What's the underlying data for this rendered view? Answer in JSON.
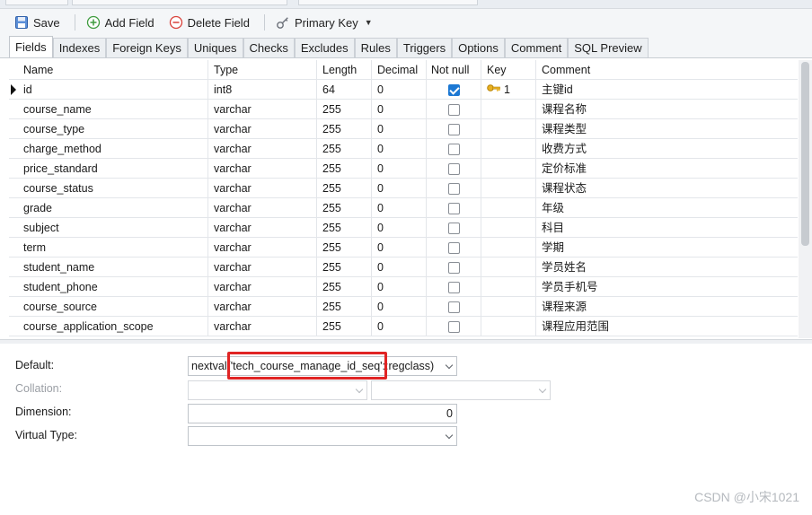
{
  "toolbar": {
    "save": "Save",
    "add_field": "Add Field",
    "delete_field": "Delete Field",
    "primary_key": "Primary Key"
  },
  "tabs": [
    "Fields",
    "Indexes",
    "Foreign Keys",
    "Uniques",
    "Checks",
    "Excludes",
    "Rules",
    "Triggers",
    "Options",
    "Comment",
    "SQL Preview"
  ],
  "active_tab": "Fields",
  "grid": {
    "columns": [
      "Name",
      "Type",
      "Length",
      "Decimal",
      "Not null",
      "Key",
      "Comment"
    ],
    "rows": [
      {
        "name": "id",
        "type": "int8",
        "length": "64",
        "decimal": "0",
        "not_null": true,
        "key": "1",
        "comment": "主键id"
      },
      {
        "name": "course_name",
        "type": "varchar",
        "length": "255",
        "decimal": "0",
        "not_null": false,
        "key": "",
        "comment": "课程名称"
      },
      {
        "name": "course_type",
        "type": "varchar",
        "length": "255",
        "decimal": "0",
        "not_null": false,
        "key": "",
        "comment": "课程类型"
      },
      {
        "name": "charge_method",
        "type": "varchar",
        "length": "255",
        "decimal": "0",
        "not_null": false,
        "key": "",
        "comment": "收费方式"
      },
      {
        "name": "price_standard",
        "type": "varchar",
        "length": "255",
        "decimal": "0",
        "not_null": false,
        "key": "",
        "comment": "定价标准"
      },
      {
        "name": "course_status",
        "type": "varchar",
        "length": "255",
        "decimal": "0",
        "not_null": false,
        "key": "",
        "comment": "课程状态"
      },
      {
        "name": "grade",
        "type": "varchar",
        "length": "255",
        "decimal": "0",
        "not_null": false,
        "key": "",
        "comment": "年级"
      },
      {
        "name": "subject",
        "type": "varchar",
        "length": "255",
        "decimal": "0",
        "not_null": false,
        "key": "",
        "comment": "科目"
      },
      {
        "name": "term",
        "type": "varchar",
        "length": "255",
        "decimal": "0",
        "not_null": false,
        "key": "",
        "comment": "学期"
      },
      {
        "name": "student_name",
        "type": "varchar",
        "length": "255",
        "decimal": "0",
        "not_null": false,
        "key": "",
        "comment": "学员姓名"
      },
      {
        "name": "student_phone",
        "type": "varchar",
        "length": "255",
        "decimal": "0",
        "not_null": false,
        "key": "",
        "comment": "学员手机号"
      },
      {
        "name": "course_source",
        "type": "varchar",
        "length": "255",
        "decimal": "0",
        "not_null": false,
        "key": "",
        "comment": "课程来源"
      },
      {
        "name": "course_application_scope",
        "type": "varchar",
        "length": "255",
        "decimal": "0",
        "not_null": false,
        "key": "",
        "comment": "课程应用范围"
      }
    ]
  },
  "properties": {
    "default_label": "Default:",
    "default_value": "nextval('tech_course_manage_id_seq'::regclass)",
    "collation_label": "Collation:",
    "collation_value": "",
    "collation_value_2": "",
    "dimension_label": "Dimension:",
    "dimension_value": "0",
    "virtual_type_label": "Virtual Type:",
    "virtual_type_value": ""
  },
  "watermark": "CSDN @小宋1021",
  "colors": {
    "accent": "#1c78d3",
    "highlight_box": "#e02424"
  }
}
